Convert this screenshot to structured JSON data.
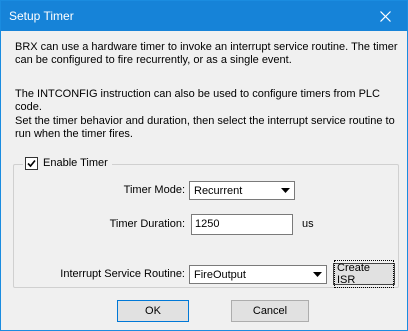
{
  "window": {
    "title": "Setup Timer"
  },
  "description": {
    "paragraph1": [
      "BRX can use a hardware timer to invoke an interrupt service routine. The timer",
      "can be configured to fire recurrently, or as a single event."
    ],
    "paragraph2": "The INTCONFIG instruction can also be used to configure timers from PLC code.",
    "paragraph3": [
      "Set the timer behavior and duration, then select the interrupt service routine to",
      "run when the timer fires."
    ]
  },
  "enable_timer": {
    "label": "Enable Timer",
    "checked": true
  },
  "timer_mode": {
    "label": "Timer Mode:",
    "value": "Recurrent"
  },
  "timer_duration": {
    "label": "Timer Duration:",
    "value": "1250",
    "unit": "us"
  },
  "isr": {
    "label": "Interrupt Service Routine:",
    "value": "FireOutput",
    "create_label": "Create ISR"
  },
  "buttons": {
    "ok": "OK",
    "cancel": "Cancel"
  }
}
